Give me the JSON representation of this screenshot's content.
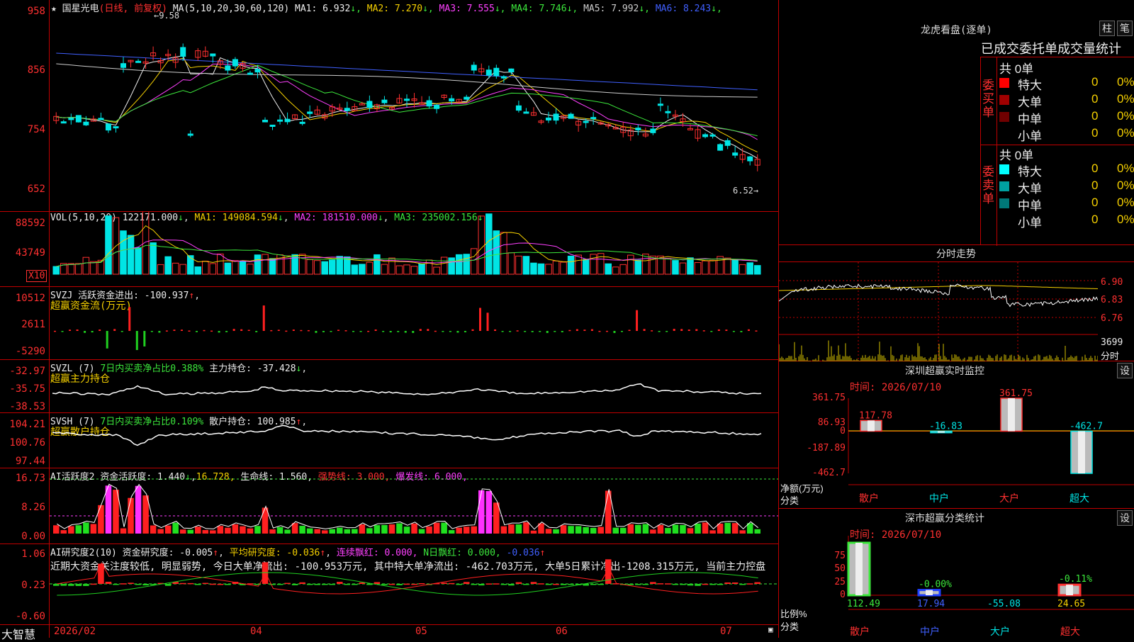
{
  "app": {
    "brand": "大智慧"
  },
  "kline": {
    "stock_name": "国星光电",
    "period": "(日线, 前复权)",
    "ma_header": "MA(5,10,20,30,60,120)",
    "ma_values": [
      {
        "label": "MA1:",
        "value": "6.932",
        "color": "#eeeeee"
      },
      {
        "label": "MA2:",
        "value": "7.270",
        "color": "#f5d000"
      },
      {
        "label": "MA3:",
        "value": "7.555",
        "color": "#ff40ff"
      },
      {
        "label": "MA4:",
        "value": "7.746",
        "color": "#3ce83c"
      },
      {
        "label": "MA5:",
        "value": "7.992",
        "color": "#cccccc"
      },
      {
        "label": "MA6:",
        "value": "8.243",
        "color": "#4060ff"
      }
    ],
    "y_labels": [
      "958",
      "856",
      "754",
      "652"
    ],
    "high_marker": "9.58",
    "low_marker": "6.52"
  },
  "volume": {
    "header": "VOL(5,10,20)",
    "value": "122171.000",
    "ma1": "MA1: 149084.594",
    "ma2": "MA2: 181510.000",
    "ma3": "MA3: 235002.156",
    "y_labels": [
      "88592",
      "43749"
    ],
    "unit": "X10"
  },
  "svzj": {
    "header": "SVZJ",
    "sub": "活跃资金进出: -100.937",
    "title": "超赢资金流(万元)",
    "y_labels": [
      "10512",
      "2611",
      "-5290"
    ]
  },
  "svzl": {
    "header": "SVZL (7)",
    "ratio": "7日内买卖净占比0.388%",
    "hold": "主力持仓: -37.428",
    "title": "超赢主力持仓",
    "y_labels": [
      "-32.97",
      "-35.75",
      "-38.53"
    ]
  },
  "svsh": {
    "header": "SVSH (7)",
    "ratio": "7日内买卖净占比0.109%",
    "hold": "散户持仓: 100.985",
    "title": "超赢散户持仓",
    "y_labels": [
      "104.21",
      "100.76",
      "97.44"
    ]
  },
  "ai_active": {
    "header": "AI活跃度2",
    "act": "资金活跃度: 1.440",
    "val2": "16.728,",
    "life": "生命线: 1.560,",
    "strong": "强势线: 3.000,",
    "burst": "爆发线: 6.000,",
    "y_labels": [
      "16.73",
      "8.26",
      "0.00"
    ]
  },
  "ai_research": {
    "header": "AI研究度2(10)",
    "res": "资金研究度: -0.005",
    "avg": "平均研究度: -0.036",
    "cont": "连续飘红: 0.000,",
    "nday": "N日飘红: 0.000,",
    "last": "-0.036",
    "text": "近期大资金关注度较低, 明显弱势, 今日大单净流出: -100.953万元, 其中特大单净流出: -462.703万元, 大单5日累计净出-1208.315万元, 当前主力控盘",
    "y_labels": [
      "1.06",
      "0.23",
      "-0.60"
    ]
  },
  "dates": [
    "2026/02",
    "04",
    "05",
    "06",
    "07"
  ],
  "longhu": {
    "title": "龙虎看盘(逐单)",
    "btn1": "柱",
    "btn2": "笔",
    "subtitle": "已成交委托单成交量统计",
    "buy_label": "委买单",
    "sell_label": "委卖单",
    "buy_total": "共 0单",
    "sell_total": "共 0单",
    "buy_rows": [
      {
        "name": "特大",
        "value": "0",
        "pct": "0%",
        "color": "#ff0000"
      },
      {
        "name": "大单",
        "value": "0",
        "pct": "0%",
        "color": "#a00000"
      },
      {
        "name": "中单",
        "value": "0",
        "pct": "0%",
        "color": "#700000"
      },
      {
        "name": "小单",
        "value": "0",
        "pct": "0%",
        "color": ""
      }
    ],
    "sell_rows": [
      {
        "name": "特大",
        "value": "0",
        "pct": "0%",
        "color": "#00ffff"
      },
      {
        "name": "大单",
        "value": "0",
        "pct": "0%",
        "color": "#00a0a0"
      },
      {
        "name": "中单",
        "value": "0",
        "pct": "0%",
        "color": "#007878"
      },
      {
        "name": "小单",
        "value": "0",
        "pct": "0%",
        "color": ""
      }
    ]
  },
  "fenshi": {
    "title": "分时走势",
    "y_labels": [
      "6.90",
      "6.83",
      "6.76"
    ],
    "vol_label": "3699",
    "vol_unit": "分时"
  },
  "sz_monitor": {
    "title": "深圳超赢实时监控",
    "btn": "设",
    "time": "时间: 2026/07/10",
    "y_labels": [
      "361.75",
      "86.93",
      "0",
      "-187.89",
      "-462.7"
    ],
    "ylabel": "净额(万元)",
    "xlabel": "分类",
    "categories": [
      "散户",
      "中户",
      "大户",
      "超大"
    ],
    "values": [
      117.78,
      -16.83,
      361.75,
      -462.7
    ],
    "value_labels": [
      "117.78",
      "-16.83",
      "361.75",
      "-462.7"
    ]
  },
  "sz_class": {
    "title": "深市超赢分类统计",
    "btn": "设",
    "time": "时间: 2026/07/10",
    "y_labels": [
      "75",
      "50",
      "25",
      "0"
    ],
    "ylabel": "比例%",
    "xlabel": "分类",
    "categories": [
      "散户",
      "中户",
      "大户",
      "超大"
    ],
    "bottom_values": [
      "112.49",
      "17.94",
      "-55.08",
      "24.65"
    ],
    "pct_labels": [
      "-0.00%",
      "-0.11%"
    ]
  },
  "chart_data": [
    {
      "type": "bar",
      "title": "深圳超赢实时监控",
      "categories": [
        "散户",
        "中户",
        "大户",
        "超大"
      ],
      "values": [
        117.78,
        -16.83,
        361.75,
        -462.7
      ],
      "ylabel": "净额(万元)",
      "xlabel": "分类",
      "ylim": [
        -462.7,
        361.75
      ]
    },
    {
      "type": "bar",
      "title": "深市超赢分类统计",
      "categories": [
        "散户",
        "中户",
        "大户",
        "超大"
      ],
      "values": [
        100,
        10,
        0,
        20
      ],
      "ylabel": "比例%",
      "xlabel": "分类",
      "ylim": [
        0,
        100
      ]
    }
  ]
}
